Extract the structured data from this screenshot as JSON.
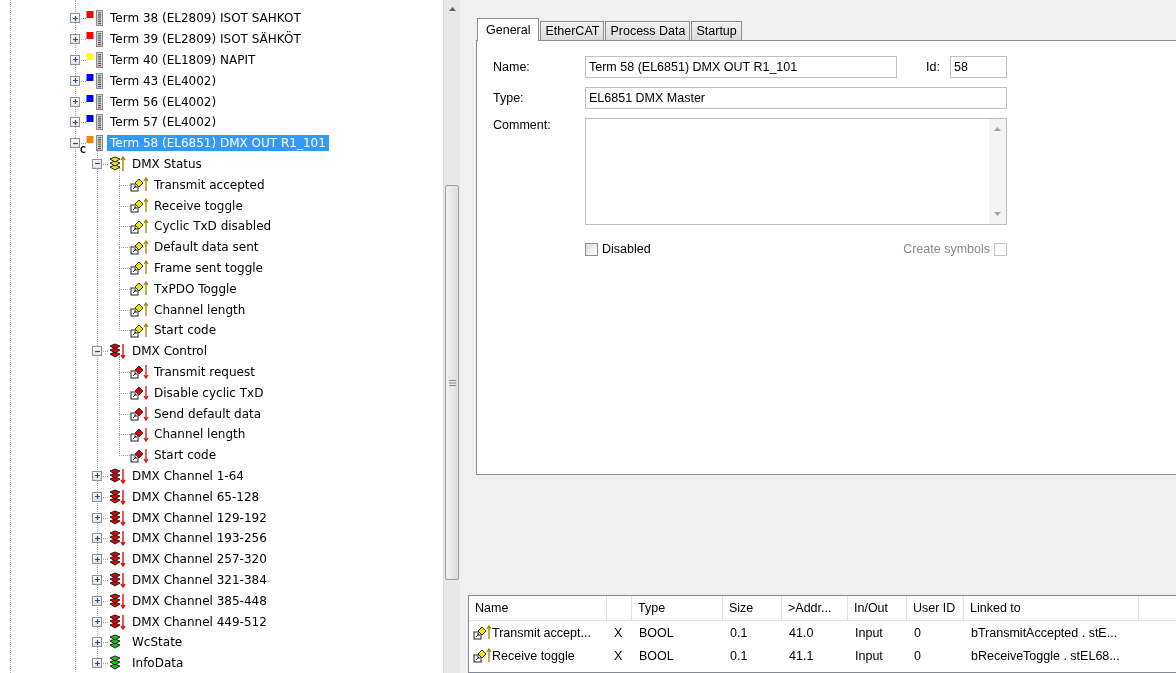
{
  "tree": {
    "items": [
      {
        "label": "Term 38 (EL2809) ISOT SAHKOT",
        "color": "#ff0000",
        "expanded": false,
        "selected": false
      },
      {
        "label": "Term 39 (EL2809) ISOT SÄHKÖT",
        "color": "#ff0000",
        "expanded": false,
        "selected": false
      },
      {
        "label": "Term 40 (EL1809) NAPIT",
        "color": "#ffff00",
        "expanded": false,
        "selected": false
      },
      {
        "label": "Term 43 (EL4002)",
        "color": "#0000ff",
        "expanded": false,
        "selected": false
      },
      {
        "label": "Term 56 (EL4002)",
        "color": "#0000ff",
        "expanded": false,
        "selected": false
      },
      {
        "label": "Term 57 (EL4002)",
        "color": "#0000ff",
        "expanded": false,
        "selected": false
      },
      {
        "label": "Term 58 (EL6851) DMX OUT R1_101",
        "color": "#ff8000",
        "badge": "C",
        "expanded": true,
        "selected": true,
        "children": [
          {
            "label": "DMX Status",
            "kind": "input",
            "expanded": true,
            "selected": false,
            "children": [
              {
                "label": "Transmit accepted",
                "kind": "input",
                "selected": false
              },
              {
                "label": "Receive toggle",
                "kind": "input",
                "selected": false
              },
              {
                "label": "Cyclic TxD disabled",
                "kind": "input",
                "selected": false
              },
              {
                "label": "Default data sent",
                "kind": "input",
                "selected": false
              },
              {
                "label": "Frame sent toggle",
                "kind": "input",
                "selected": false
              },
              {
                "label": "TxPDO Toggle",
                "kind": "input",
                "selected": false
              },
              {
                "label": "Channel length",
                "kind": "input",
                "selected": false
              },
              {
                "label": "Start code",
                "kind": "input",
                "selected": false
              }
            ]
          },
          {
            "label": "DMX Control",
            "kind": "output",
            "expanded": true,
            "selected": false,
            "children": [
              {
                "label": "Transmit request",
                "kind": "output",
                "selected": false
              },
              {
                "label": "Disable cyclic TxD",
                "kind": "output",
                "selected": false
              },
              {
                "label": "Send default data",
                "kind": "output",
                "selected": false
              },
              {
                "label": "Channel length",
                "kind": "output",
                "selected": false
              },
              {
                "label": "Start code",
                "kind": "output",
                "selected": false
              }
            ]
          },
          {
            "label": "DMX Channel 1-64",
            "kind": "output",
            "expanded": false,
            "selected": false
          },
          {
            "label": "DMX Channel 65-128",
            "kind": "output",
            "expanded": false,
            "selected": false
          },
          {
            "label": "DMX Channel 129-192",
            "kind": "output",
            "expanded": false,
            "selected": false
          },
          {
            "label": "DMX Channel 193-256",
            "kind": "output",
            "expanded": false,
            "selected": false
          },
          {
            "label": "DMX Channel 257-320",
            "kind": "output",
            "expanded": false,
            "selected": false
          },
          {
            "label": "DMX Channel 321-384",
            "kind": "output",
            "expanded": false,
            "selected": false
          },
          {
            "label": "DMX Channel 385-448",
            "kind": "output",
            "expanded": false,
            "selected": false
          },
          {
            "label": "DMX Channel 449-512",
            "kind": "output",
            "expanded": false,
            "selected": false
          },
          {
            "label": "WcState",
            "kind": "status",
            "expanded": false,
            "selected": false
          },
          {
            "label": "InfoData",
            "kind": "status",
            "expanded": false,
            "selected": false
          }
        ]
      }
    ]
  },
  "tabs": [
    {
      "label": "General",
      "selected": true
    },
    {
      "label": "EtherCAT",
      "selected": false
    },
    {
      "label": "Process Data",
      "selected": false
    },
    {
      "label": "Startup",
      "selected": false
    }
  ],
  "general": {
    "name_label": "Name:",
    "name_value": "Term 58 (EL6851) DMX OUT R1_101",
    "id_label": "Id:",
    "id_value": "58",
    "type_label": "Type:",
    "type_value": "EL6851 DMX Master",
    "comment_label": "Comment:",
    "disabled": {
      "label": "Disabled",
      "checked": false
    },
    "create_symbols": {
      "label": "Create symbols",
      "checked": false,
      "disabled": true
    }
  },
  "table": {
    "columns": [
      "Name",
      "",
      "Type",
      "Size",
      ">Addr...",
      "In/Out",
      "User ID",
      "Linked to"
    ],
    "rows": [
      {
        "kind": "input",
        "cells": [
          "Transmit accept...",
          "X",
          "BOOL",
          "0.1",
          "41.0",
          "Input",
          "0",
          "bTransmitAccepted . stE..."
        ]
      },
      {
        "kind": "input",
        "cells": [
          "Receive toggle",
          "X",
          "BOOL",
          "0.1",
          "41.1",
          "Input",
          "0",
          "bReceiveToggle . stEL68..."
        ]
      }
    ]
  }
}
